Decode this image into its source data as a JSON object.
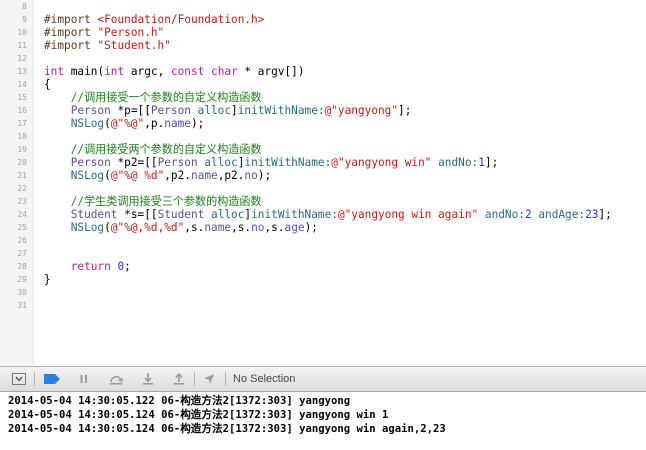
{
  "editor": {
    "line_numbers": [
      "8",
      "9",
      "10",
      "11",
      "12",
      "13",
      "14",
      "15",
      "16",
      "17",
      "18",
      "19",
      "20",
      "21",
      "22",
      "23",
      "24",
      "25",
      "26",
      "27",
      "28",
      "29",
      "30",
      "31"
    ],
    "lines": [
      [],
      [
        {
          "t": "#import ",
          "c": "pre"
        },
        {
          "t": "<Foundation/Foundation.h>",
          "c": "str"
        }
      ],
      [
        {
          "t": "#import ",
          "c": "pre"
        },
        {
          "t": "\"Person.h\"",
          "c": "str"
        }
      ],
      [
        {
          "t": "#import ",
          "c": "pre"
        },
        {
          "t": "\"Student.h\"",
          "c": "str"
        }
      ],
      [],
      [
        {
          "t": "int",
          "c": "kw"
        },
        {
          "t": " main(",
          "c": "pl"
        },
        {
          "t": "int",
          "c": "kw"
        },
        {
          "t": " argc, ",
          "c": "pl"
        },
        {
          "t": "const",
          "c": "kw"
        },
        {
          "t": " ",
          "c": "pl"
        },
        {
          "t": "char",
          "c": "kw"
        },
        {
          "t": " * argv[])",
          "c": "pl"
        }
      ],
      [
        {
          "t": "{",
          "c": "pl"
        }
      ],
      [
        {
          "t": "    //调用接受一个参数的自定义构造函数",
          "c": "cmt"
        }
      ],
      [
        {
          "t": "    ",
          "c": "pl"
        },
        {
          "t": "Person",
          "c": "cls"
        },
        {
          "t": " *p=[[",
          "c": "pl"
        },
        {
          "t": "Person",
          "c": "cls"
        },
        {
          "t": " ",
          "c": "pl"
        },
        {
          "t": "alloc",
          "c": "fn"
        },
        {
          "t": "]",
          "c": "pl"
        },
        {
          "t": "initWithName:",
          "c": "fn"
        },
        {
          "t": "@\"yangyong\"",
          "c": "str"
        },
        {
          "t": "];",
          "c": "pl"
        }
      ],
      [
        {
          "t": "    ",
          "c": "pl"
        },
        {
          "t": "NSLog",
          "c": "fn"
        },
        {
          "t": "(",
          "c": "pl"
        },
        {
          "t": "@\"%@\"",
          "c": "str"
        },
        {
          "t": ",p.",
          "c": "pl"
        },
        {
          "t": "name",
          "c": "cls"
        },
        {
          "t": ");",
          "c": "pl"
        }
      ],
      [],
      [
        {
          "t": "    //调用接受两个参数的自定义构造函数",
          "c": "cmt"
        }
      ],
      [
        {
          "t": "    ",
          "c": "pl"
        },
        {
          "t": "Person",
          "c": "cls"
        },
        {
          "t": " *p2=[[",
          "c": "pl"
        },
        {
          "t": "Person",
          "c": "cls"
        },
        {
          "t": " ",
          "c": "pl"
        },
        {
          "t": "alloc",
          "c": "fn"
        },
        {
          "t": "]",
          "c": "pl"
        },
        {
          "t": "initWithName:",
          "c": "fn"
        },
        {
          "t": "@\"yangyong win\"",
          "c": "str"
        },
        {
          "t": " ",
          "c": "pl"
        },
        {
          "t": "andNo:",
          "c": "fn"
        },
        {
          "t": "1",
          "c": "num"
        },
        {
          "t": "];",
          "c": "pl"
        }
      ],
      [
        {
          "t": "    ",
          "c": "pl"
        },
        {
          "t": "NSLog",
          "c": "fn"
        },
        {
          "t": "(",
          "c": "pl"
        },
        {
          "t": "@\"%@ %d\"",
          "c": "str"
        },
        {
          "t": ",p2.",
          "c": "pl"
        },
        {
          "t": "name",
          "c": "cls"
        },
        {
          "t": ",p2.",
          "c": "pl"
        },
        {
          "t": "no",
          "c": "cls"
        },
        {
          "t": ");",
          "c": "pl"
        }
      ],
      [],
      [
        {
          "t": "    //学生类调用接受三个参数的构造函数",
          "c": "cmt"
        }
      ],
      [
        {
          "t": "    ",
          "c": "pl"
        },
        {
          "t": "Student",
          "c": "cls"
        },
        {
          "t": " *s=[[",
          "c": "pl"
        },
        {
          "t": "Student",
          "c": "cls"
        },
        {
          "t": " ",
          "c": "pl"
        },
        {
          "t": "alloc",
          "c": "fn"
        },
        {
          "t": "]",
          "c": "pl"
        },
        {
          "t": "initWithName:",
          "c": "fn"
        },
        {
          "t": "@\"yangyong win again\"",
          "c": "str"
        },
        {
          "t": " ",
          "c": "pl"
        },
        {
          "t": "andNo:",
          "c": "fn"
        },
        {
          "t": "2",
          "c": "num"
        },
        {
          "t": " ",
          "c": "pl"
        },
        {
          "t": "andAge:",
          "c": "fn"
        },
        {
          "t": "23",
          "c": "num"
        },
        {
          "t": "];",
          "c": "pl"
        }
      ],
      [
        {
          "t": "    ",
          "c": "pl"
        },
        {
          "t": "NSLog",
          "c": "fn"
        },
        {
          "t": "(",
          "c": "pl"
        },
        {
          "t": "@\"%@,%d,%d\"",
          "c": "str"
        },
        {
          "t": ",s.",
          "c": "pl"
        },
        {
          "t": "name",
          "c": "cls"
        },
        {
          "t": ",s.",
          "c": "pl"
        },
        {
          "t": "no",
          "c": "cls"
        },
        {
          "t": ",s.",
          "c": "pl"
        },
        {
          "t": "age",
          "c": "cls"
        },
        {
          "t": ");",
          "c": "pl"
        }
      ],
      [],
      [],
      [
        {
          "t": "    ",
          "c": "pl"
        },
        {
          "t": "return",
          "c": "kw"
        },
        {
          "t": " ",
          "c": "pl"
        },
        {
          "t": "0",
          "c": "num"
        },
        {
          "t": ";",
          "c": "pl"
        }
      ],
      [
        {
          "t": "}",
          "c": "pl"
        }
      ],
      [],
      []
    ]
  },
  "debug_bar": {
    "selection_label": "No Selection",
    "icons": [
      "hide-debug-area-icon",
      "breakpoints-toggle-icon",
      "pause-icon",
      "step-over-icon",
      "step-into-icon",
      "step-out-icon",
      "simulate-location-icon"
    ],
    "accent_color": "#2f7de1"
  },
  "console": {
    "lines": [
      "2014-05-04 14:30:05.122 06-构造方法2[1372:303] yangyong",
      "2014-05-04 14:30:05.124 06-构造方法2[1372:303] yangyong win 1",
      "2014-05-04 14:30:05.124 06-构造方法2[1372:303] yangyong win again,2,23"
    ]
  }
}
